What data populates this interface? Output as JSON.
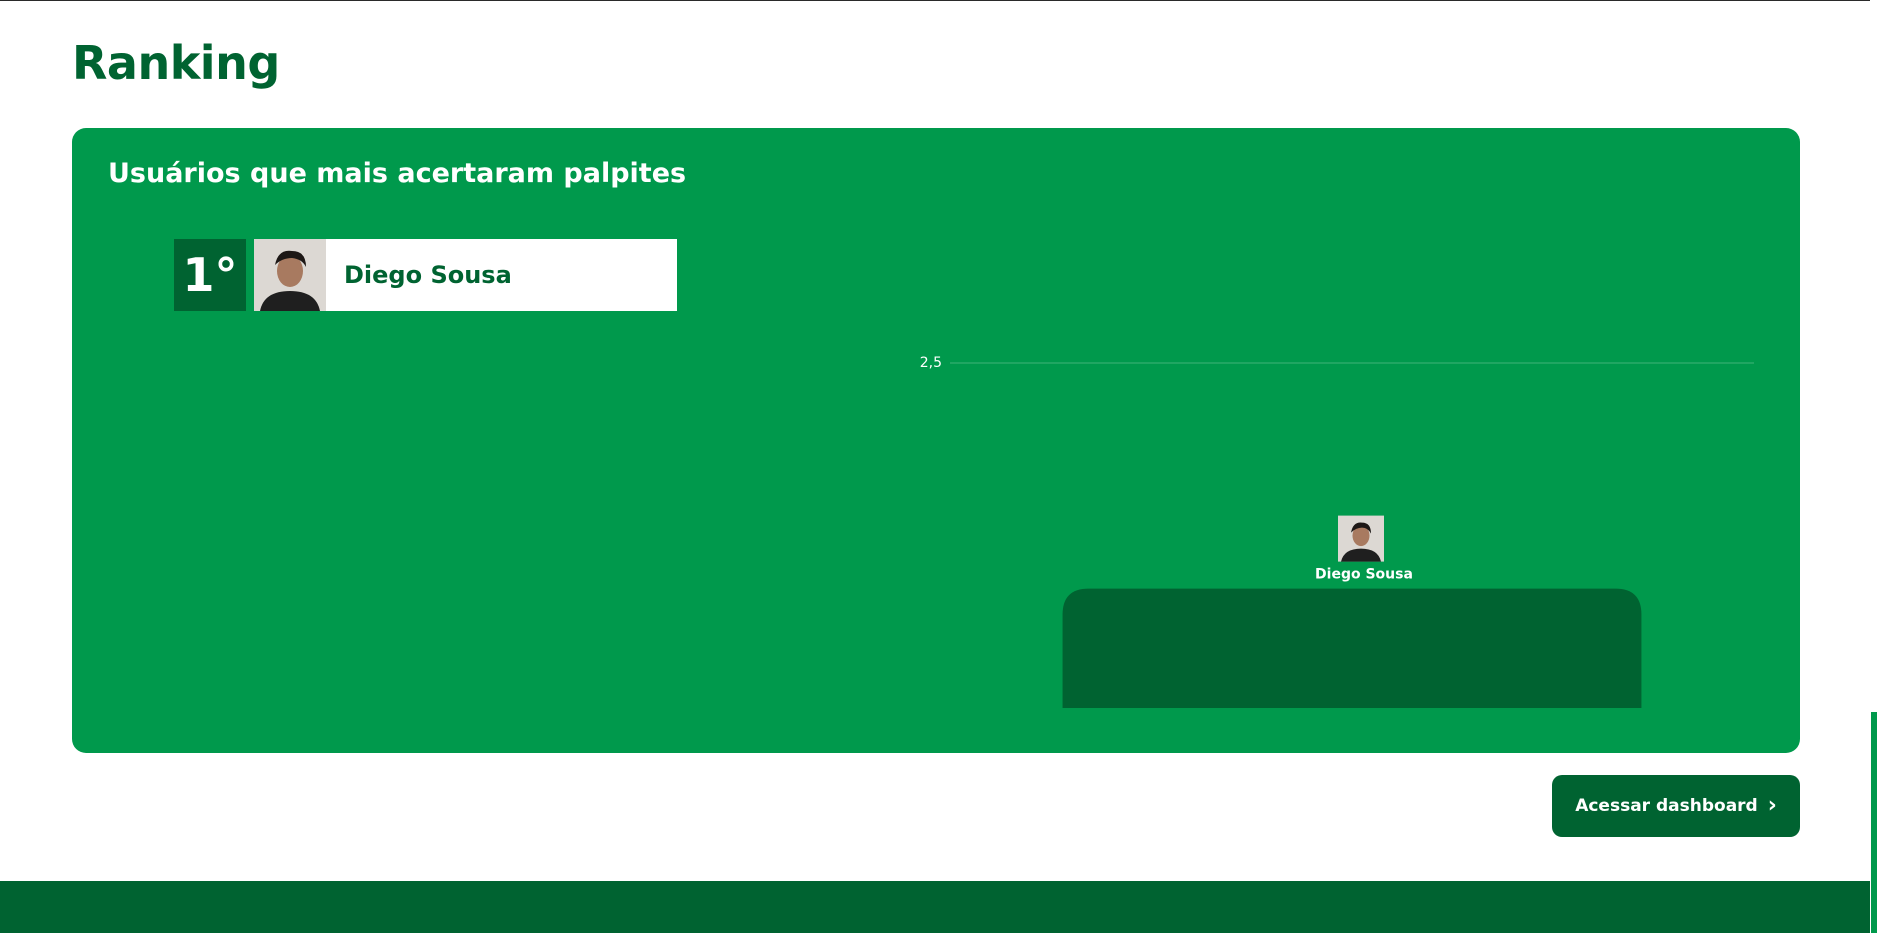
{
  "page": {
    "title": "Ranking"
  },
  "ranking": {
    "card_title": "Usuários que mais acertaram palpites",
    "entries": [
      {
        "position": "1°",
        "name": "Diego Sousa",
        "avatar": "user-photo"
      }
    ]
  },
  "actions": {
    "dashboard_label": "Acessar dashboard",
    "dashboard_icon": "chevron-right-icon"
  },
  "colors": {
    "brand_dark": "#006331",
    "brand": "#00994c",
    "white": "#ffffff"
  },
  "chart_data": {
    "type": "bar",
    "categories": [
      "1°"
    ],
    "values": [
      1
    ],
    "bar_labels": [
      "Diego Sousa"
    ],
    "ylim": [
      0,
      2.5
    ],
    "y_ticks": [
      "0",
      "2,5"
    ],
    "grid": true,
    "title": "",
    "xlabel": "",
    "ylabel": ""
  }
}
